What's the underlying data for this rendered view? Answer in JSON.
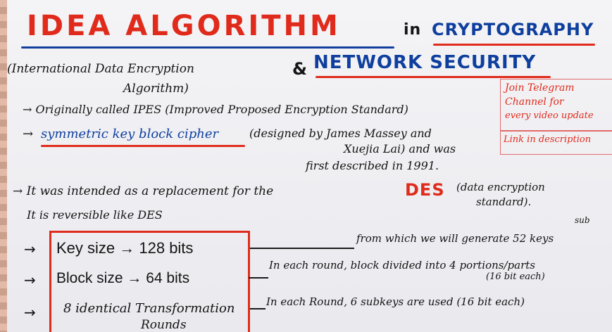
{
  "title": {
    "main": "IDEA ALGORITHM",
    "in": "in",
    "crypto": "CRYPTOGRAPHY",
    "amp": "&",
    "netsec": "NETWORK SECURITY"
  },
  "subtitle": {
    "line1": "(International Data Encryption",
    "line2": "Algorithm)"
  },
  "telegram": {
    "line1": "Join Telegram",
    "line2": "Channel for",
    "line3": "every video update",
    "line4": "Link in description"
  },
  "points": {
    "p1": "→ Originally called IPES (Improved Proposed Encryption Standard)",
    "p2a": "→",
    "p2b": "symmetric key block cipher",
    "p2c": "(designed by James Massey and",
    "p2d": "Xuejia Lai) and was",
    "p2e": "first described in 1991.",
    "p3a": "→ It was intended as a replacement for the",
    "p3b": "DES",
    "p3c": "(data encryption",
    "p3d": "standard).",
    "p4": "It is reversible like DES"
  },
  "box": {
    "key_size": "Key size → 128 bits",
    "block_size": "Block size → 64 bits",
    "rounds1": "8 identical Transformation",
    "rounds2": "Rounds"
  },
  "notes": {
    "key": "from which we will generate 52 keys",
    "key_sup": "sub",
    "block1": "In each round, block divided into 4 portions/parts",
    "block2": "(16 bit each)",
    "rounds": "In each Round, 6 subkeys are used (16 bit each)"
  },
  "arrows": {
    "a1": "→",
    "a2": "→",
    "a3": "→"
  }
}
